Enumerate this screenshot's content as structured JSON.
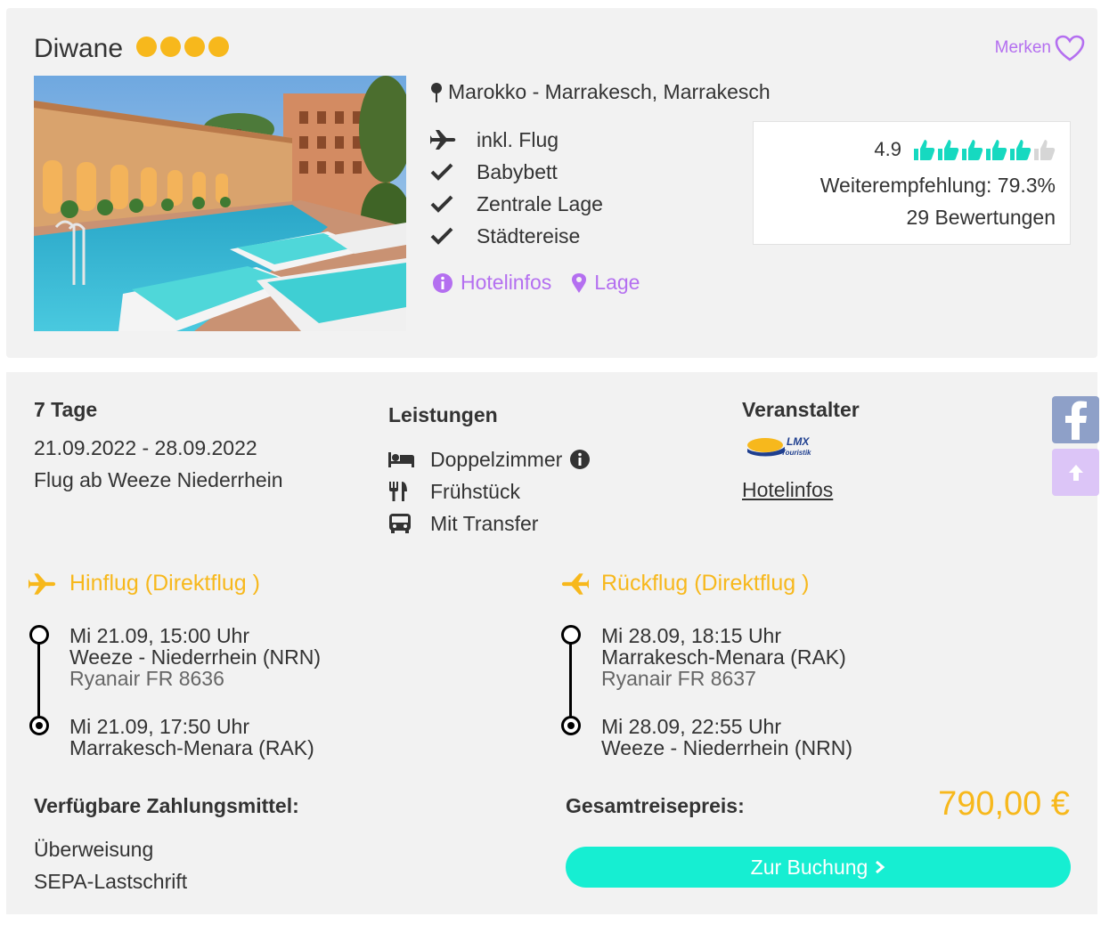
{
  "hotel": {
    "name": "Diwane",
    "stars": 4,
    "merken_label": "Merken",
    "location": "Marokko - Marrakesch, Marrakesch",
    "features": [
      {
        "icon": "plane-icon",
        "label": "inkl. Flug"
      },
      {
        "icon": "check-icon",
        "label": "Babybett"
      },
      {
        "icon": "check-icon",
        "label": "Zentrale Lage"
      },
      {
        "icon": "check-icon",
        "label": "Städtereise"
      }
    ],
    "links": {
      "hotelinfos": "Hotelinfos",
      "lage": "Lage"
    }
  },
  "rating": {
    "score": "4.9",
    "thumbs_filled": 5,
    "thumbs_total": 6,
    "recommendation": "Weiterempfehlung: 79.3%",
    "reviews": "29 Bewertungen"
  },
  "trip": {
    "duration": "7 Tage",
    "dates": "21.09.2022 - 28.09.2022",
    "departure": "Flug ab Weeze Niederrhein"
  },
  "leistungen": {
    "title": "Leistungen",
    "items": [
      {
        "icon": "bed-icon",
        "label": "Doppelzimmer"
      },
      {
        "icon": "cutlery-icon",
        "label": "Frühstück"
      },
      {
        "icon": "bus-icon",
        "label": "Mit Transfer"
      }
    ]
  },
  "veranstalter": {
    "title": "Veranstalter",
    "logo_text": "LMX Touristik",
    "link": "Hotelinfos"
  },
  "hinflug": {
    "title": "Hinflug (Direktflug )",
    "dep_time": "Mi 21.09, 15:00 Uhr",
    "dep_airport": "Weeze - Niederrhein (NRN)",
    "airline": "Ryanair FR 8636",
    "arr_time": "Mi 21.09, 17:50 Uhr",
    "arr_airport": "Marrakesch-Menara (RAK)"
  },
  "rueckflug": {
    "title": "Rückflug (Direktflug )",
    "dep_time": "Mi 28.09, 18:15 Uhr",
    "dep_airport": "Marrakesch-Menara (RAK)",
    "airline": "Ryanair FR 8637",
    "arr_time": "Mi 28.09, 22:55 Uhr",
    "arr_airport": "Weeze - Niederrhein (NRN)"
  },
  "payment": {
    "title": "Verfügbare Zahlungsmittel:",
    "methods": [
      "Überweisung",
      "SEPA-Lastschrift"
    ]
  },
  "price": {
    "label": "Gesamtreisepreis:",
    "value": "790,00 €"
  },
  "booking": {
    "label": "Zur Buchung"
  },
  "colors": {
    "accent_purple": "#b46ff0",
    "accent_orange": "#f7b81c",
    "accent_teal": "#16eed2",
    "card_bg": "#f2f2f2"
  }
}
